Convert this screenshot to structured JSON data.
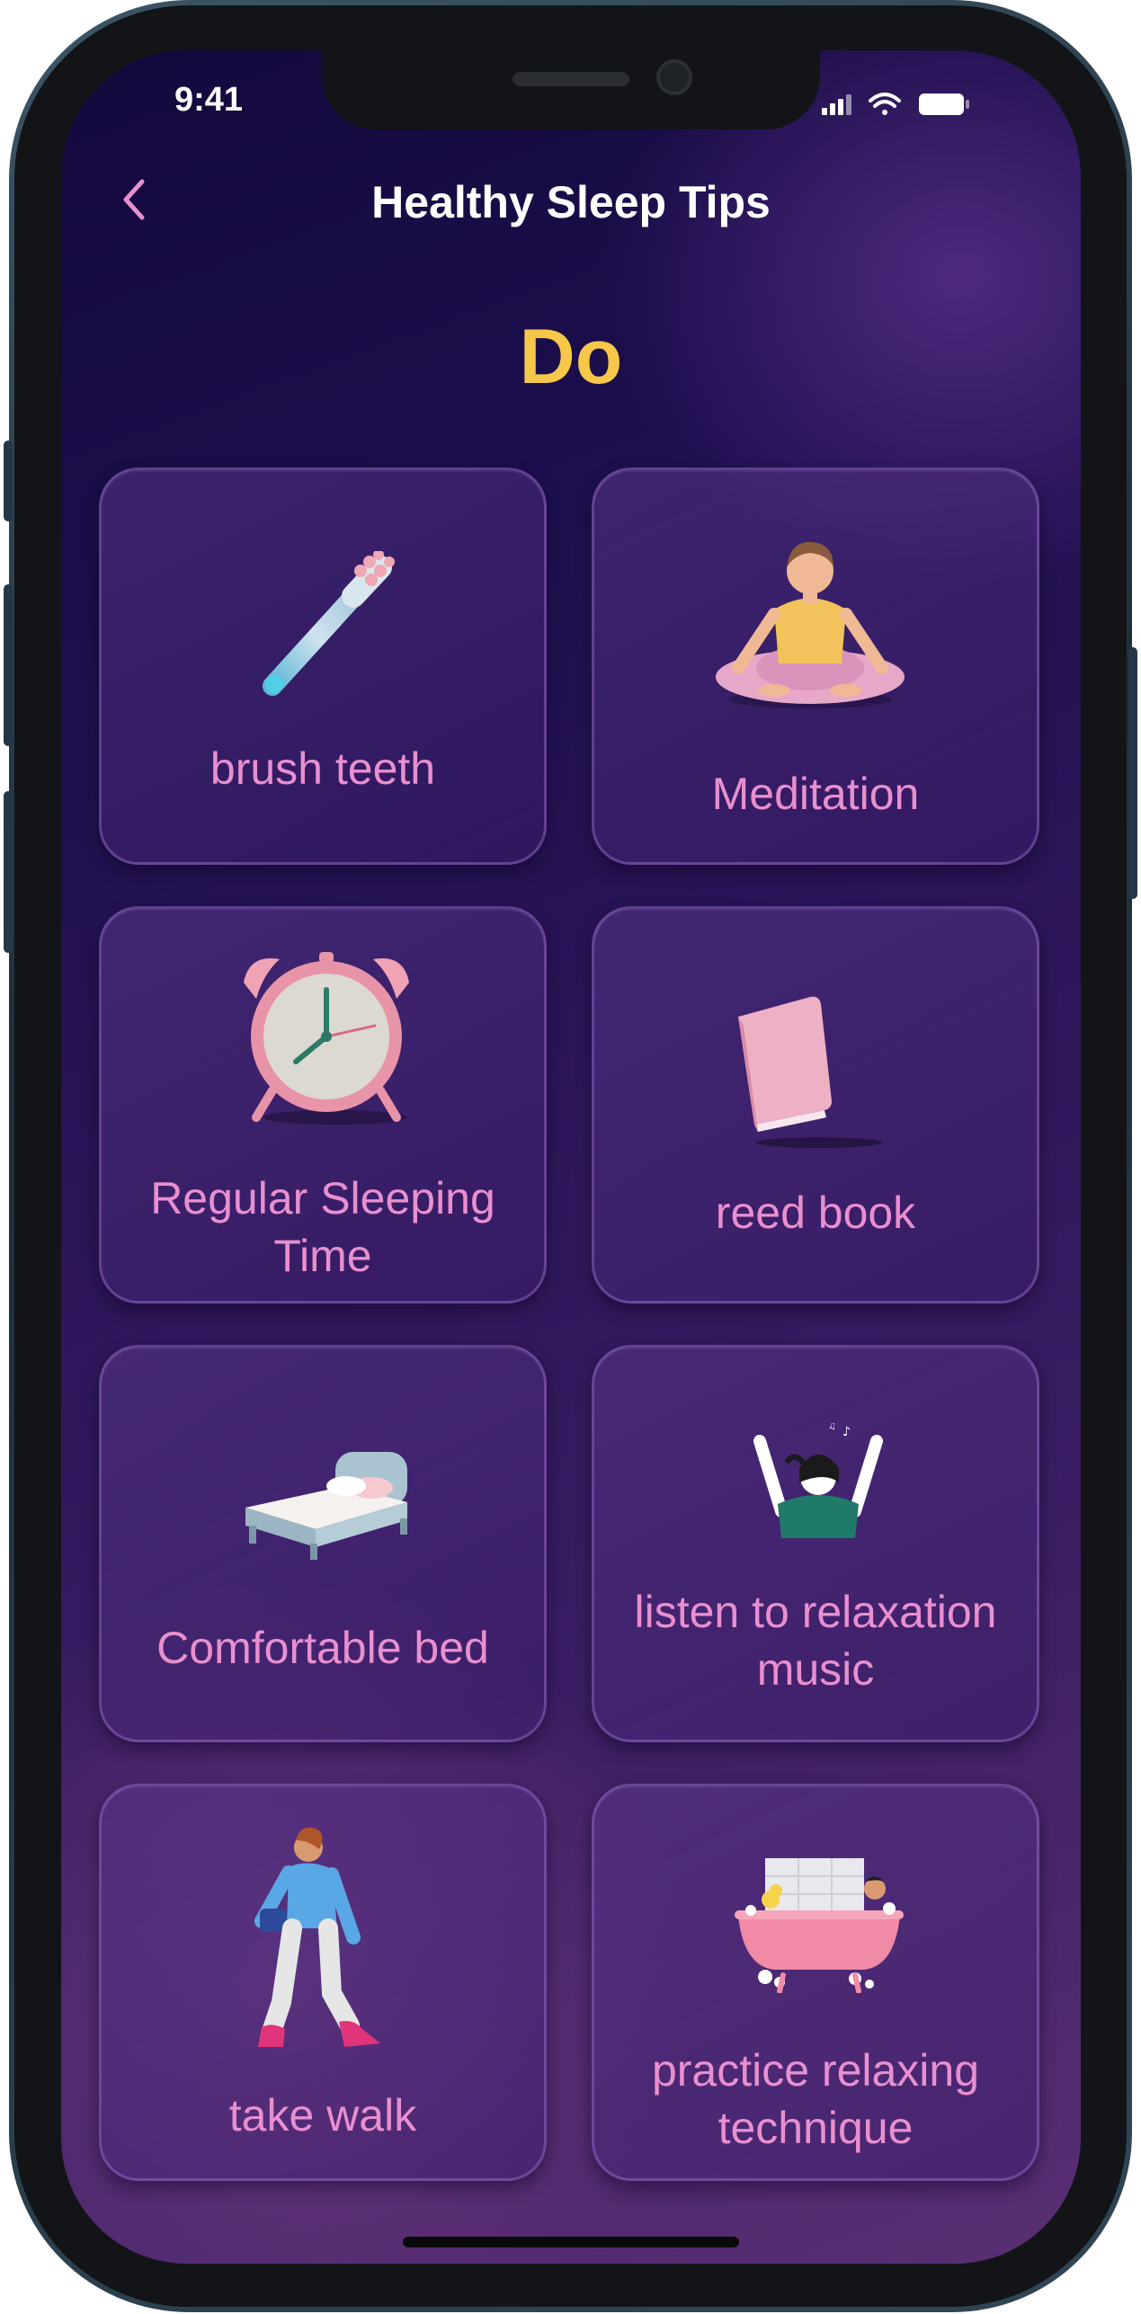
{
  "status_bar": {
    "time": "9:41"
  },
  "header": {
    "title": "Healthy Sleep Tips",
    "back_icon": "chevron-left-icon"
  },
  "section_title": "Do",
  "colors": {
    "accent": "#f5c84a",
    "card_label": "#e98fcf",
    "background_top": "#14093d",
    "background_bottom": "#5a2f74"
  },
  "cards": [
    {
      "label": "brush teeth",
      "icon": "toothbrush-illustration"
    },
    {
      "label": "Meditation",
      "icon": "meditation-illustration"
    },
    {
      "label": "Regular Sleeping Time",
      "icon": "alarm-clock-illustration"
    },
    {
      "label": "reed book",
      "icon": "book-illustration"
    },
    {
      "label": "Comfortable bed",
      "icon": "bed-illustration"
    },
    {
      "label": "listen to relaxation music",
      "icon": "headphones-music-illustration"
    },
    {
      "label": "take walk",
      "icon": "walking-person-illustration"
    },
    {
      "label": "practice relaxing technique",
      "icon": "bathtub-illustration"
    }
  ]
}
